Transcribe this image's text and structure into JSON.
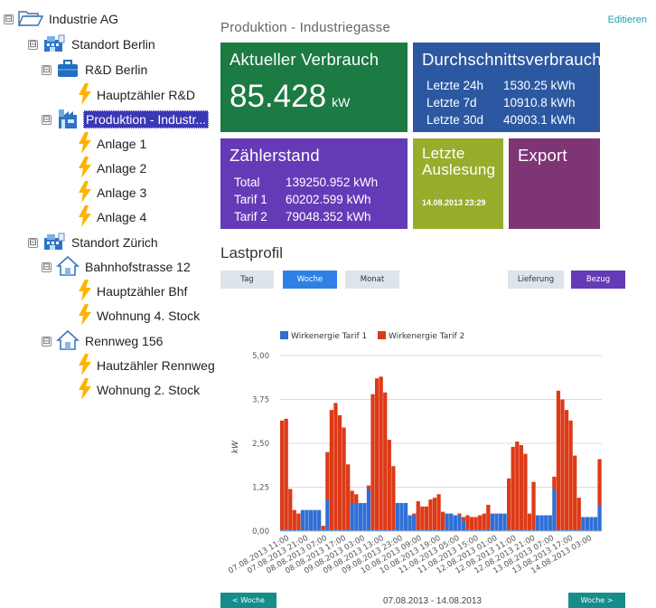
{
  "tree": {
    "root": "Industrie AG",
    "site_berlin": "Standort Berlin",
    "rd_berlin": "R&D Berlin",
    "hz_rd": "Hauptzähler R&D",
    "produktion": "Produktion - Industr...",
    "anlage1": "Anlage 1",
    "anlage2": "Anlage 2",
    "anlage3": "Anlage 3",
    "anlage4": "Anlage 4",
    "site_zurich": "Standort Zürich",
    "bahnhof": "Bahnhofstrasse 12",
    "hz_bhf": "Hauptzähler Bhf",
    "wohnung4": "Wohnung 4. Stock",
    "rennweg": "Rennweg 156",
    "hz_rennweg": "Hautzähler Rennweg",
    "wohnung2": "Wohnung 2. Stock",
    "expander_glyph": "⊟"
  },
  "header": {
    "title": "Produktion - Industriegasse",
    "edit": "Editieren"
  },
  "tiles": {
    "consumption": {
      "title": "Aktueller Verbrauch",
      "value": "85.428",
      "unit": "kW"
    },
    "average": {
      "title": "Durchschnittsverbrauch",
      "rows": [
        {
          "label": "Letzte 24h",
          "value": "1530.25 kWh"
        },
        {
          "label": "Letzte 7d",
          "value": "10910.8 kWh"
        },
        {
          "label": "Letzte 30d",
          "value": "40903.1 kWh"
        }
      ]
    },
    "meter": {
      "title": "Zählerstand",
      "rows": [
        {
          "label": "Total",
          "value": "139250.952 kWh"
        },
        {
          "label": "Tarif 1",
          "value": "60202.599 kWh"
        },
        {
          "label": "Tarif 2",
          "value": "79048.352 kWh"
        }
      ]
    },
    "lastread": {
      "title_line1": "Letzte",
      "title_line2": "Auslesung",
      "timestamp": "14.08.2013 23:29"
    },
    "export": {
      "title": "Export"
    }
  },
  "section": {
    "title": "Lastprofil"
  },
  "buttons": {
    "tag": "Tag",
    "woche": "Woche",
    "monat": "Monat",
    "lieferung": "Lieferung",
    "bezug": "Bezug"
  },
  "footer": {
    "prev": "< Woche",
    "range": "07.08.2013 - 14.08.2013",
    "next": "Woche >"
  },
  "colors": {
    "tarif1": "#2f6fd6",
    "tarif2": "#dd3a17",
    "accent": "#168d8b"
  },
  "chart_data": {
    "type": "bar",
    "stacked": true,
    "ylabel": "kW",
    "ylim": [
      0,
      5
    ],
    "yticks": [
      "0,00",
      "1,25",
      "2,50",
      "3,75",
      "5,00"
    ],
    "x_tick_labels": [
      "07.08.2013 11:00",
      "07.08.2013 21:00",
      "08.08.2013 07:00",
      "08.08.2013 17:00",
      "09.08.2013 03:00",
      "09.08.2013 13:00",
      "09.08.2013 23:00",
      "10.08.2013 09:00",
      "10.08.2013 19:00",
      "11.08.2013 05:00",
      "11.08.2013 15:00",
      "12.08.2013 01:00",
      "12.08.2013 11:00",
      "12.08.2013 21:00",
      "13.08.2013 07:00",
      "13.08.2013 17:00",
      "14.08.2013 03:00"
    ],
    "legend_position": "top",
    "grid": true,
    "series": [
      {
        "name": "Wirkenergie Tarif 1",
        "values": [
          0.05,
          0.05,
          0.05,
          0.05,
          0.05,
          0.6,
          0.6,
          0.6,
          0.6,
          0.6,
          0.05,
          0.9,
          0.05,
          0.05,
          0.05,
          0.05,
          0.05,
          0.8,
          0.8,
          0.8,
          0.8,
          1.2,
          0.05,
          0.05,
          0.05,
          0.05,
          0.05,
          0.05,
          0.8,
          0.8,
          0.8,
          0.45,
          0.45,
          0.05,
          0.05,
          0.05,
          0.05,
          0.05,
          0.05,
          0.05,
          0.5,
          0.5,
          0.45,
          0.45,
          0.3,
          0.05,
          0.05,
          0.05,
          0.05,
          0.05,
          0.05,
          0.5,
          0.5,
          0.5,
          0.5,
          0.05,
          0.05,
          0.05,
          0.05,
          0.05,
          0.05,
          0.05,
          0.45,
          0.45,
          0.45,
          0.45,
          1.2,
          0.05,
          0.05,
          0.05,
          0.05,
          0.05,
          0.05,
          0.4,
          0.4,
          0.4,
          0.4,
          0.75
        ]
      },
      {
        "name": "Wirkenergie Tarif 2",
        "values": [
          3.1,
          3.15,
          1.15,
          0.55,
          0.45,
          0,
          0,
          0,
          0,
          0,
          0.1,
          1.35,
          3.4,
          3.6,
          3.25,
          2.9,
          1.85,
          0.35,
          0.25,
          0.0,
          0,
          0.1,
          3.85,
          4.3,
          4.35,
          3.9,
          2.55,
          1.8,
          0,
          0,
          0,
          0,
          0.05,
          0.8,
          0.65,
          0.65,
          0.85,
          0.9,
          1.0,
          0.5,
          0,
          0,
          0,
          0.05,
          0.1,
          0.4,
          0.35,
          0.35,
          0.4,
          0.45,
          0.7,
          0,
          0,
          0,
          0,
          1.45,
          2.35,
          2.5,
          2.4,
          2.15,
          0.45,
          1.35,
          0,
          0,
          0,
          0,
          0.35,
          3.95,
          3.7,
          3.4,
          3.1,
          2.1,
          0.9,
          0,
          0,
          0,
          0,
          1.3
        ]
      }
    ]
  }
}
